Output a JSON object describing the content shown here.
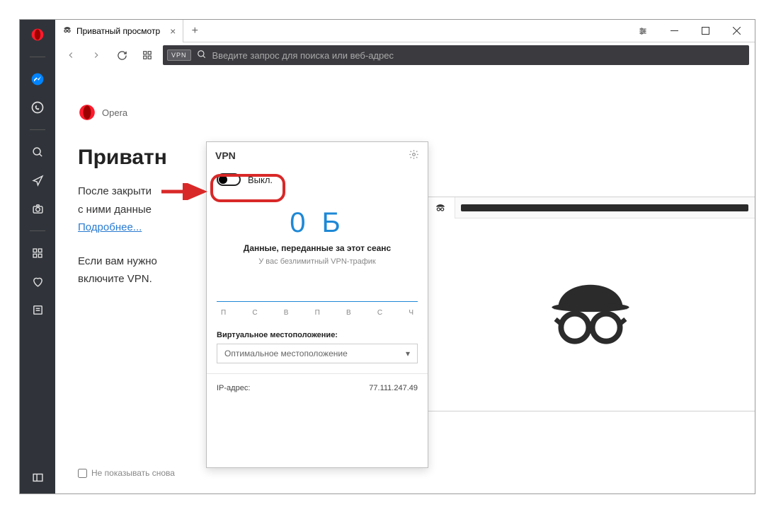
{
  "tab": {
    "title": "Приватный просмотр"
  },
  "addressbar": {
    "vpn_badge": "VPN",
    "placeholder": "Введите запрос для поиска или веб-адрес"
  },
  "page": {
    "brand": "Opera",
    "title": "Приватн",
    "line1": "После закрыти",
    "line2": "с ними данные",
    "more_link": "Подробнее...",
    "line3": "Если вам нужно",
    "line4": "включите VPN.",
    "dont_show": "Не показывать снова"
  },
  "vpn": {
    "title": "VPN",
    "toggle_label": "Выкл.",
    "data_amount": "0 Б",
    "data_label": "Данные, переданные за этот сеанс",
    "unlimited": "У вас безлимитный VPN-трафик",
    "days": [
      "П",
      "С",
      "В",
      "П",
      "В",
      "С",
      "Ч"
    ],
    "location_label": "Виртуальное местоположение:",
    "location_value": "Оптимальное местоположение",
    "ip_label": "IP-адрес:",
    "ip_value": "77.111.247.49"
  }
}
